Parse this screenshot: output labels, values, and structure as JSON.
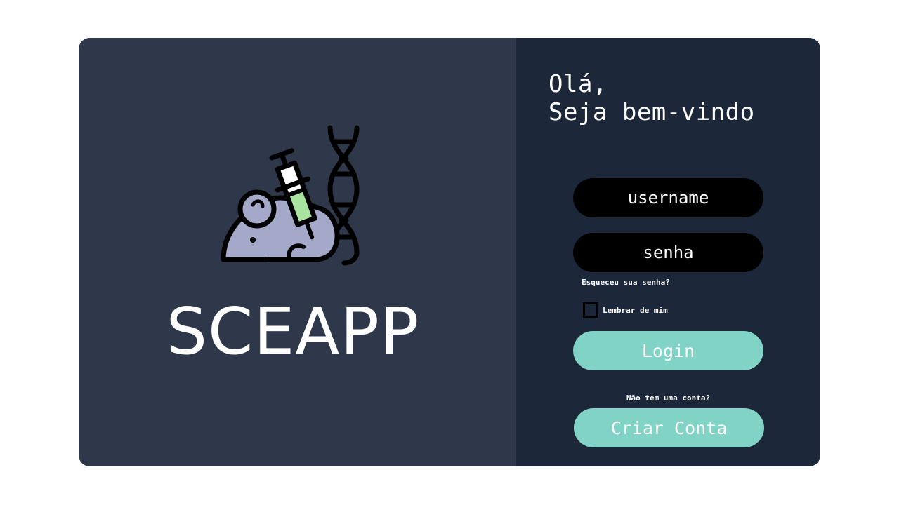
{
  "brand": {
    "name": "SCEAPP",
    "logo_icon": "lab-mouse-syringe-dna-icon"
  },
  "greeting": {
    "line1": "Olá,",
    "line2": "Seja bem-vindo"
  },
  "form": {
    "username_placeholder": "username",
    "password_placeholder": "senha",
    "forgot_password": "Esqueceu sua senha?",
    "remember_me": "Lembrar de mim",
    "login_label": "Login",
    "no_account": "Não tem uma conta?",
    "create_account_label": "Criar Conta"
  },
  "colors": {
    "left_panel": "#2f384b",
    "right_panel": "#1c2839",
    "accent": "#80d3c5",
    "mouse_fill": "#a4a9c9",
    "syringe_fluid": "#a8e4a0"
  }
}
